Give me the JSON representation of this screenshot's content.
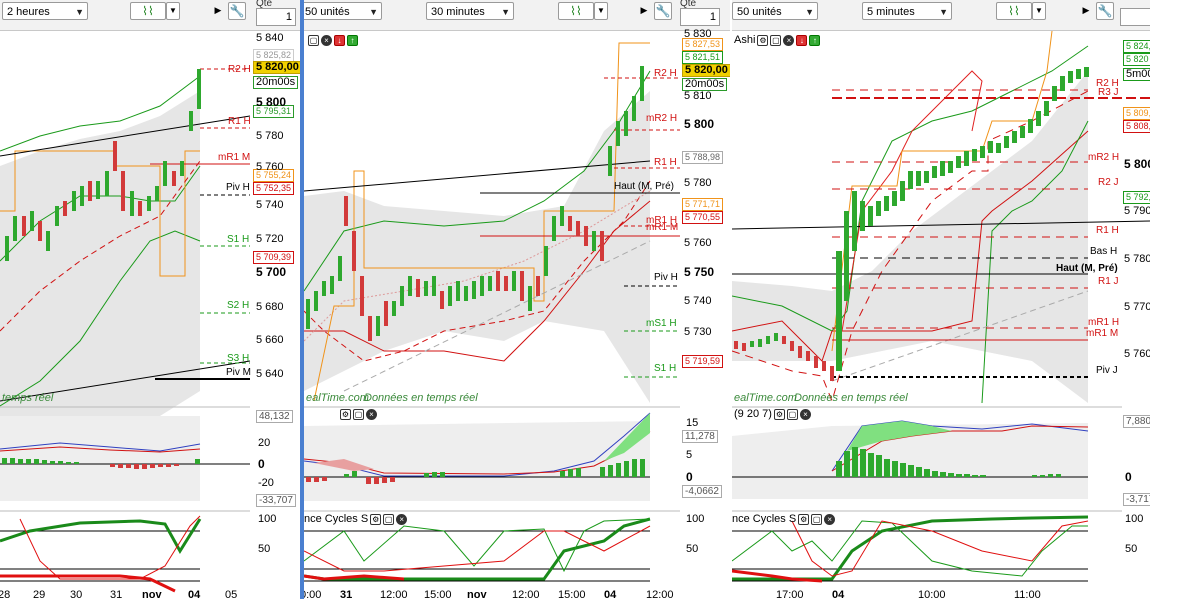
{
  "colors": {
    "bull": "#2ea82e",
    "bear": "#d23a3a",
    "band": "#1a9a1a",
    "orange": "#f0931a",
    "red": "#d11111",
    "black": "#000000",
    "current_bg": "#f0d000"
  },
  "panel1": {
    "period_select": "2 heures",
    "qte_label": "Qte",
    "qte_value": "1",
    "price_axis": [
      "5 840",
      "5 800",
      "5 780",
      "5 760",
      "5 740",
      "5 720",
      "5 700",
      "5 680",
      "5 660",
      "5 640"
    ],
    "price_tags": {
      "p1": "5 825,82",
      "current": "5 820,00",
      "timer": "20m00s",
      "p2": "5 795,31",
      "p3": "5 755,24",
      "p4": "5 752,35",
      "p5": "5 709,39"
    },
    "levels": {
      "r2": "R2 H",
      "r1": "R1 H",
      "mr1": "mR1 M",
      "piv": "Piv H",
      "s1": "S1 H",
      "s2": "S2 H",
      "s3": "S3 H",
      "pivm": "Piv M"
    },
    "watermark": "temps réel",
    "ind1_axis": [
      "20",
      "0",
      "-20"
    ],
    "ind1_tags": {
      "top": "48,132",
      "bottom": "-33,707"
    },
    "ind2_axis": [
      "100",
      "50"
    ],
    "time_axis": [
      "28",
      "29",
      "30",
      "31",
      "nov",
      "04",
      "05"
    ]
  },
  "panel2": {
    "units_select": "50 unités",
    "period_select": "30 minutes",
    "qte_label": "Qte",
    "qte_value": "1",
    "price_axis": [
      "5 830",
      "5 810",
      "5 800",
      "5 780",
      "5 760",
      "5 750",
      "5 740",
      "5 730",
      "5 720"
    ],
    "price_tags": {
      "p1": "5 827,53",
      "p2": "5 821,51",
      "current": "5 820,00",
      "timer": "20m00s",
      "p3": "5 788,98",
      "p4": "5 771,71",
      "p5": "5 770,55",
      "p6": "5 719,59"
    },
    "levels": {
      "r2": "R2 H",
      "mr2": "mR2 H",
      "r1": "R1 H",
      "haut": "Haut (M, Pré)",
      "mr1": "mR1 H",
      "mr1m": "mR1 M",
      "piv": "Piv H",
      "ms1": "mS1 H",
      "s1": "S1 H"
    },
    "watermark_a": "ealTime.com",
    "watermark_b": "Données en temps réel",
    "ind1_axis": [
      "15",
      "5",
      "0"
    ],
    "ind1_tags": {
      "top": "11,278",
      "bottom": "-4,0662"
    },
    "ind2_title": "nce Cycles S",
    "ind2_axis": [
      "100",
      "50"
    ],
    "time_axis": [
      "0:00",
      "31",
      "12:00",
      "15:00",
      "nov",
      "12:00",
      "15:00",
      "04",
      "12:00"
    ]
  },
  "panel3": {
    "units_select": "50 unités",
    "period_select": "5 minutes",
    "chart_title": "Ashi",
    "price_axis": [
      "5 824",
      "5 820",
      "5 809",
      "5 808",
      "5 800",
      "5 792",
      "5 790",
      "5 780",
      "5 770",
      "5 760"
    ],
    "price_tags": {
      "p1": "5 824,",
      "p2": "5 820",
      "p3": "5 809,",
      "p4": "5 808,",
      "p5": "5 792,",
      "current_short": "5m00s"
    },
    "levels": {
      "r2": "R2 H",
      "r3": "R3 J",
      "mr2": "mR2 H",
      "r2j": "R2 J",
      "r1": "R1 H",
      "bas": "Bas H",
      "haut": "Haut (M, Pré)",
      "r1j": "R1 J",
      "mr1": "mR1 H",
      "mr1m": "mR1 M",
      "piv": "Piv J"
    },
    "watermark_a": "ealTime.com",
    "watermark_b": "Données en temps réel",
    "ind1_title": "(9 20 7)",
    "ind1_axis": [
      "0"
    ],
    "ind1_tags": {
      "top": "7,880",
      "bottom": "-3,717"
    },
    "ind2_title": "nce Cycles S",
    "ind2_axis": [
      "100",
      "50"
    ],
    "time_axis": [
      "17:00",
      "04",
      "10:00",
      "11:00"
    ]
  }
}
